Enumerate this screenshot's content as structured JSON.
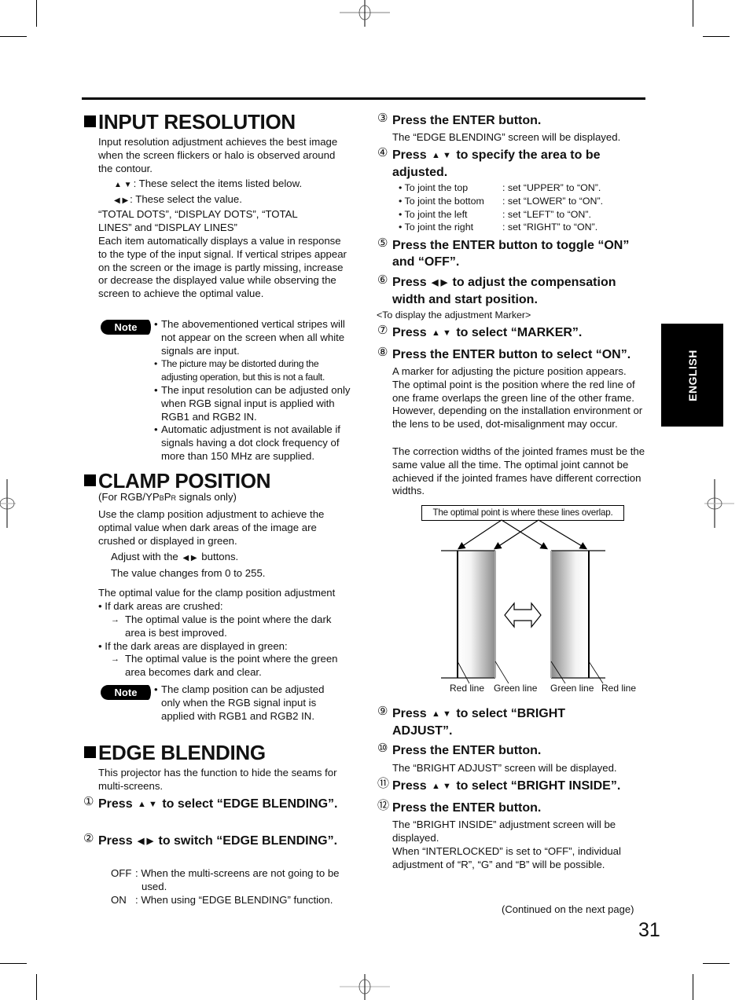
{
  "page": {
    "page_number": "31",
    "side_tab": "ENGLISH",
    "continued": "(Continued on the next page)"
  },
  "input_resolution": {
    "title": "INPUT RESOLUTION",
    "intro": "Input resolution adjustment achieves the best image when the screen flickers or halo is observed around the contour.",
    "updown_desc": ": These select the items listed below.",
    "leftright_desc": ": These select the value.",
    "items_line": "“TOTAL DOTS”, “DISPLAY DOTS”, “TOTAL LINES” and “DISPLAY LINES”",
    "body": "Each item automatically displays a value in response to the type of the input signal. If vertical stripes appear on the screen or the image is partly missing, increase or decrease the displayed value while observing the screen to achieve the optimal value.",
    "note_label": "Note",
    "notes": [
      "The abovementioned vertical stripes will not appear on the screen when all white signals are input.",
      "The picture may be distorted during the adjusting operation, but this is not a fault.",
      "The input resolution can be adjusted only when RGB signal input is applied with RGB1 and RGB2 IN.",
      "Automatic adjustment is not available if signals having a dot clock frequency of more than 150 MHz are supplied."
    ]
  },
  "clamp_position": {
    "title": "CLAMP POSITION",
    "subtitle_prefix": "(For RGB/YP",
    "subtitle_b": "B",
    "subtitle_p": "P",
    "subtitle_r": "R",
    "subtitle_suffix": " signals only)",
    "intro": "Use the clamp position adjustment to achieve the optimal value when dark areas of the image are crushed or displayed in green.",
    "adjust_prefix": "Adjust with the",
    "adjust_suffix": "buttons.",
    "range": "The value changes from 0 to 255.",
    "optimal_heading": "The optimal value for the clamp position adjustment",
    "cases": [
      {
        "condition": "If dark areas are crushed:",
        "result": "The optimal value is the point where the dark area is best improved."
      },
      {
        "condition": "If the dark areas are displayed in green:",
        "result": "The optimal value is the point where the green area becomes dark and clear."
      }
    ],
    "note_label": "Note",
    "notes": [
      "The clamp position can be adjusted only when the RGB signal input is applied with RGB1 and RGB2 IN."
    ]
  },
  "edge_blending": {
    "title": "EDGE BLENDING",
    "intro": "This projector has the function to hide the seams for multi-screens.",
    "steps": [
      {
        "num": "1",
        "pre": "Press",
        "post": "to select “EDGE BLENDING”."
      },
      {
        "num": "2",
        "pre": "Press",
        "post": "to switch “EDGE BLENDING”."
      },
      {
        "num": "3",
        "text": "Press the ENTER button.",
        "desc": "The “EDGE BLENDING” screen will be displayed."
      },
      {
        "num": "4",
        "pre": "Press",
        "post": "to specify the area to be adjusted."
      },
      {
        "num": "5",
        "text": "Press the ENTER button to toggle “ON” and “OFF”."
      },
      {
        "num": "6",
        "pre": "Press",
        "post": "to adjust the compensation width and start position."
      },
      {
        "num": "7",
        "pre": "Press",
        "post": "to select “MARKER”."
      },
      {
        "num": "8",
        "text": "Press the ENTER button to select “ON”."
      },
      {
        "num": "9",
        "pre": "Press",
        "post": "to select “BRIGHT ADJUST”."
      },
      {
        "num": "10",
        "text": "Press the ENTER button.",
        "desc": "The “BRIGHT ADJUST” screen will be displayed."
      },
      {
        "num": "11",
        "pre": "Press",
        "post": "to select “BRIGHT INSIDE”."
      },
      {
        "num": "12",
        "text": "Press the ENTER button."
      }
    ],
    "switch_options": [
      {
        "key": "OFF",
        "desc": ": When the multi-screens are not going to be used."
      },
      {
        "key": "ON",
        "desc": ": When using “EDGE BLENDING” function."
      }
    ],
    "area_options": [
      {
        "label": "• To joint the top",
        "value": ": set “UPPER” to “ON”."
      },
      {
        "label": "• To joint the bottom",
        "value": ": set “LOWER” to “ON”."
      },
      {
        "label": "• To joint the left",
        "value": ": set “LEFT” to “ON”."
      },
      {
        "label": "• To joint the right",
        "value": ": set “RIGHT” to “ON”."
      }
    ],
    "marker_heading": "<To display the adjustment Marker>",
    "marker_desc": "A marker for adjusting the picture position appears. The optimal point is the position where the red line of one frame overlaps the green line of the other frame.  However, depending on the installation environment or the lens to be used, dot-misalignment may occur.",
    "correction_desc": "The correction widths of the jointed frames must be the same value all the time. The optimal joint cannot be achieved if the jointed frames have different correction widths.",
    "diagram": {
      "caption": "The optimal point is where these lines overlap.",
      "labels": [
        "Red line",
        "Green line",
        "Green line",
        "Red line"
      ]
    },
    "bright_inside_desc": "The “BRIGHT INSIDE” adjustment screen will be displayed.",
    "interlocked_desc": "When “INTERLOCKED” is set to “OFF”, individual adjustment of “R”, “G” and “B” will be possible."
  },
  "glyphs": {
    "up_down": "▲ ▼",
    "left_right": "◀  ▶",
    "bullet": "•",
    "arrow": "→"
  }
}
